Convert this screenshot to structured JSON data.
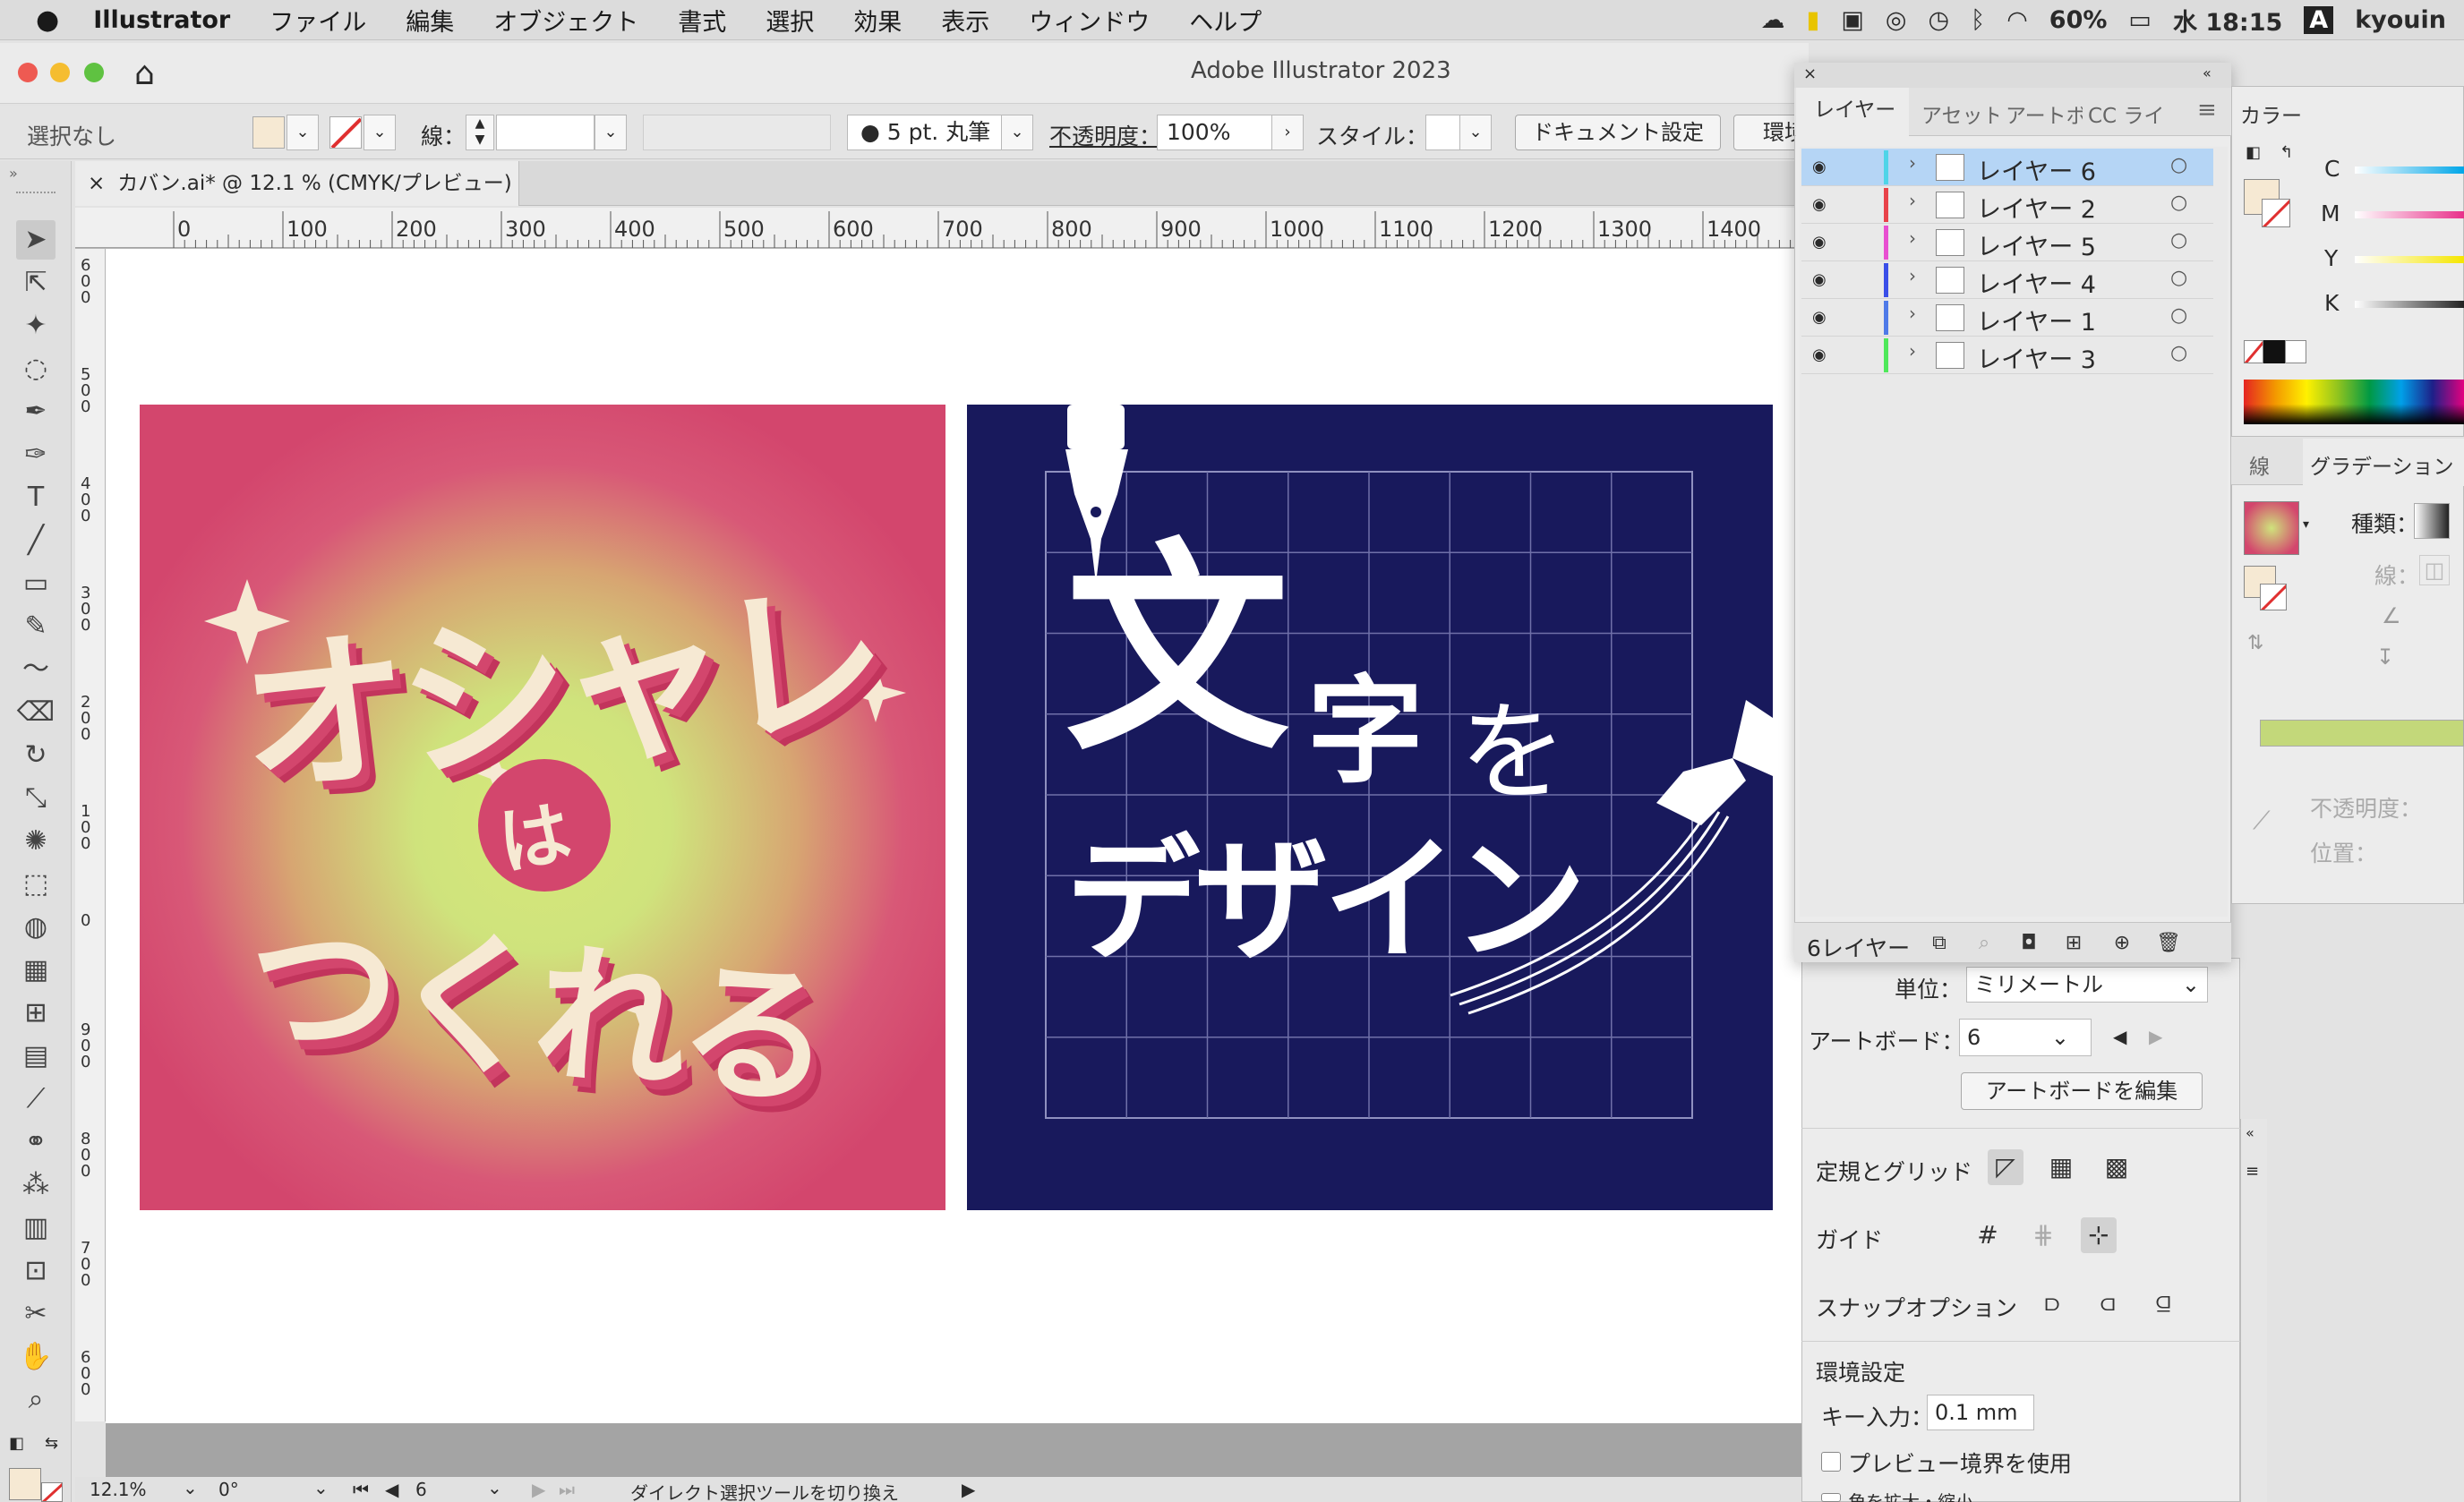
{
  "menubar": {
    "apple": "",
    "app": "Illustrator",
    "items": [
      "ファイル",
      "編集",
      "オブジェクト",
      "書式",
      "選択",
      "効果",
      "表示",
      "ウィンドウ",
      "ヘルプ"
    ],
    "battery": "60%",
    "clock": "水 18:15",
    "input": "A",
    "user": "kyouin"
  },
  "window": {
    "title": "Adobe Illustrator 2023"
  },
  "control": {
    "selection": "選択なし",
    "stroke_label": "線：",
    "brush": "5 pt. 丸筆",
    "opacity_label": "不透明度：",
    "opacity": "100%",
    "style_label": "スタイル：",
    "doc_settings": "ドキュメント設定",
    "env": "環境"
  },
  "doc": {
    "tab": "カバン.ai* @ 12.1 % (CMYK/プレビュー)",
    "close": "×"
  },
  "ruler": {
    "h": [
      "0",
      "100",
      "200",
      "300",
      "400",
      "500",
      "600",
      "700",
      "800",
      "900",
      "1000",
      "1100",
      "1200",
      "1300",
      "1400"
    ],
    "v": [
      "600",
      "500",
      "400",
      "300",
      "200",
      "100",
      "0",
      "900",
      "800",
      "700",
      "600"
    ]
  },
  "art1": {
    "top": "オシャレ",
    "middle": "は",
    "bottom": "つくれる"
  },
  "art2": {
    "line1a": "文",
    "line1b": "字",
    "line1c": "を",
    "line2": "デザイン"
  },
  "layers_panel": {
    "tabs": [
      "レイヤー",
      "アセット",
      "アートボ",
      "CC ライ"
    ],
    "menu": "≡",
    "rows": [
      {
        "name": "レイヤー 6",
        "color": "#4fd4e8",
        "selected": true
      },
      {
        "name": "レイヤー 2",
        "color": "#e8424a",
        "selected": false
      },
      {
        "name": "レイヤー 5",
        "color": "#e84fd1",
        "selected": false
      },
      {
        "name": "レイヤー 4",
        "color": "#3a4fe8",
        "selected": false
      },
      {
        "name": "レイヤー 1",
        "color": "#4f7ae8",
        "selected": false
      },
      {
        "name": "レイヤー 3",
        "color": "#4fe85a",
        "selected": false
      }
    ],
    "count": "6レイヤー"
  },
  "props": {
    "unit_label": "単位：",
    "unit": "ミリメートル",
    "artboard_label": "アートボード：",
    "artboard": "6",
    "edit_artboard": "アートボードを編集",
    "ruler_grid": "定規とグリッド",
    "guide": "ガイド",
    "snap": "スナップオプション",
    "prefs": "環境設定",
    "key_label": "キー入力：",
    "key_value": "0.1 mm",
    "preview_bounds": "プレビュー境界を使用",
    "scale": "角を拡大・縮小"
  },
  "color_panel": {
    "title": "カラー",
    "channels": [
      "C",
      "M",
      "Y",
      "K"
    ]
  },
  "gradient_panel": {
    "stroke_tab": "線",
    "title": "グラデーション",
    "type_label": "種類：",
    "stroke_label": "線：",
    "opacity_label": "不透明度：",
    "position_label": "位置："
  },
  "status": {
    "zoom": "12.1%",
    "angle": "0°",
    "artboard": "6",
    "hint": "ダイレクト選択ツールを切り換え"
  }
}
